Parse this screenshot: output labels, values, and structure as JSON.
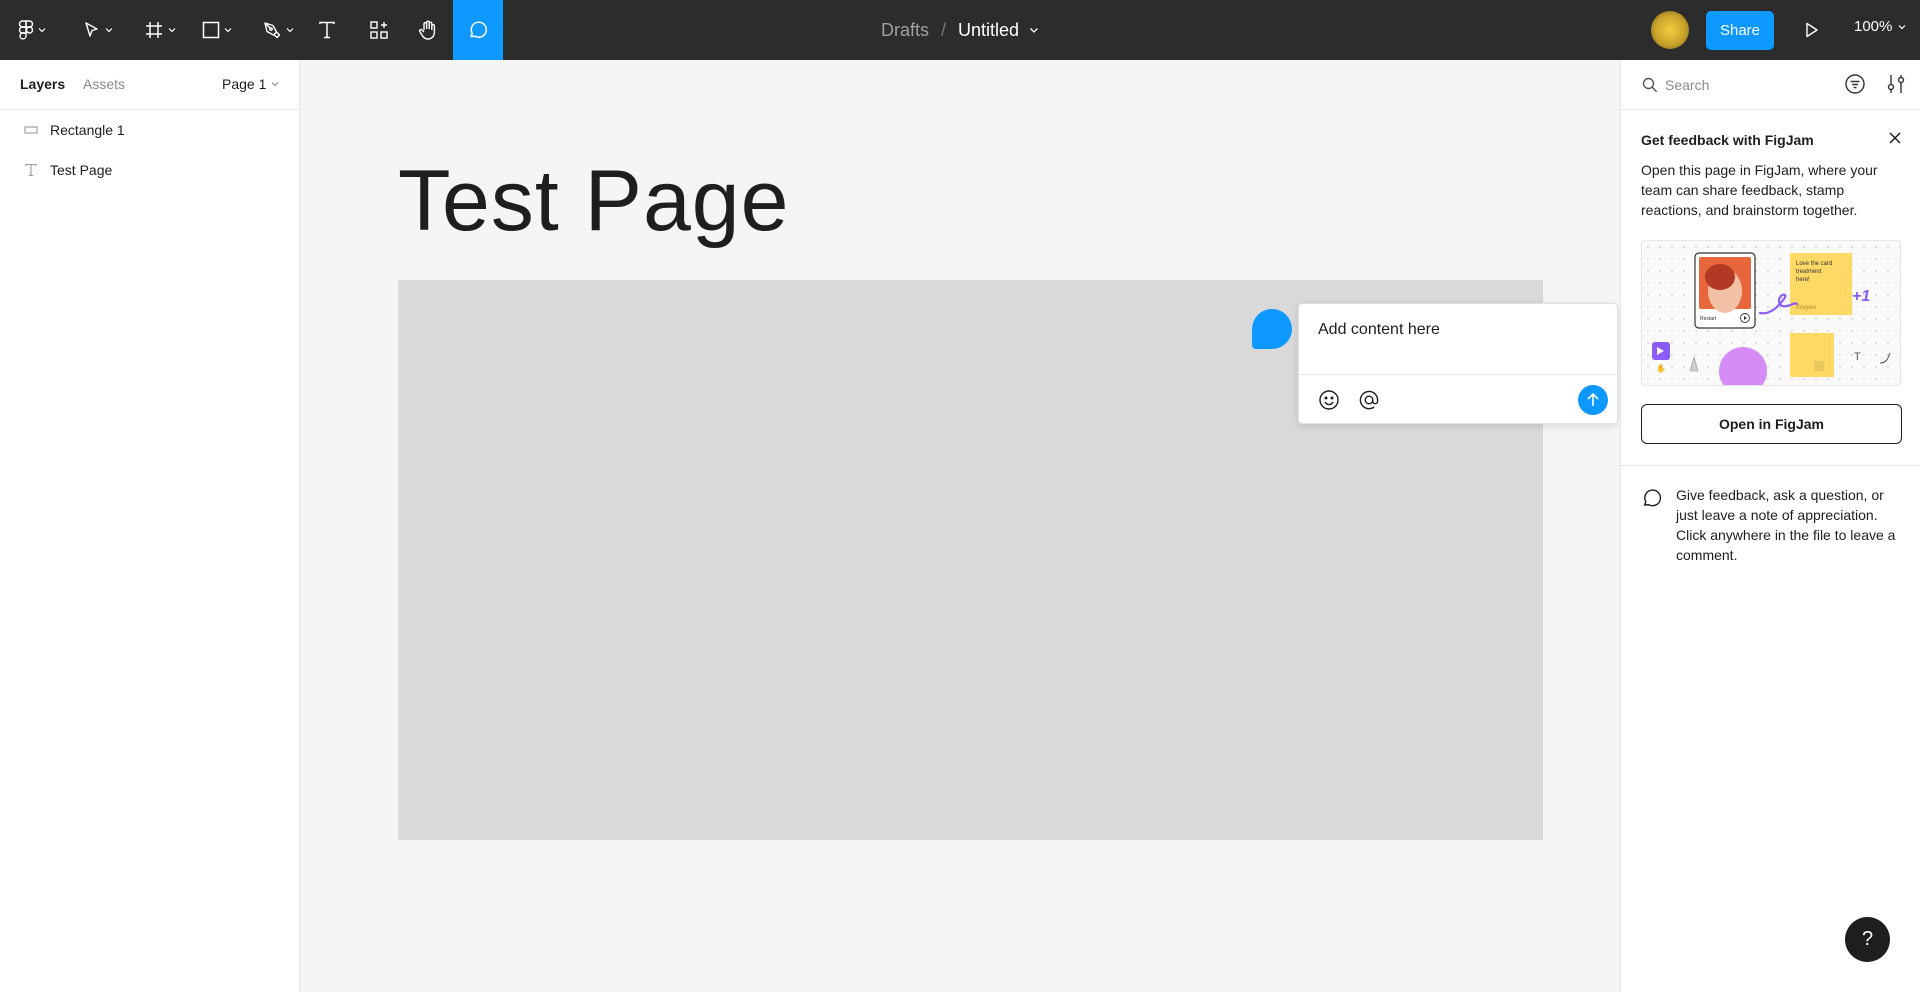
{
  "toolbar": {
    "tools": [
      {
        "name": "main-menu",
        "icon": "figma-logo-icon"
      },
      {
        "name": "move-tool",
        "icon": "cursor-icon"
      },
      {
        "name": "frame-tool",
        "icon": "frame-hash-icon"
      },
      {
        "name": "shape-tool",
        "icon": "rectangle-icon"
      },
      {
        "name": "pen-tool",
        "icon": "pen-icon"
      },
      {
        "name": "text-tool",
        "icon": "text-icon"
      },
      {
        "name": "resources-tool",
        "icon": "components-icon"
      },
      {
        "name": "hand-tool",
        "icon": "hand-icon"
      },
      {
        "name": "comment-tool",
        "icon": "comment-icon",
        "active": true
      }
    ],
    "breadcrumb": {
      "folder": "Drafts",
      "separator": "/",
      "file": "Untitled"
    },
    "share_label": "Share",
    "zoom": "100%"
  },
  "left_panel": {
    "tabs": {
      "layers": "Layers",
      "assets": "Assets"
    },
    "page": "Page 1",
    "layers": [
      {
        "name": "Rectangle 1",
        "icon": "rectangle-layer-icon"
      },
      {
        "name": "Test Page",
        "icon": "text-layer-icon"
      }
    ]
  },
  "canvas": {
    "title": "Test Page",
    "comment": {
      "placeholder": "Add content here"
    }
  },
  "right_panel": {
    "search_placeholder": "Search",
    "figjam": {
      "title": "Get feedback with FigJam",
      "text": "Open this page in FigJam, where your team can share feedback, stamp reactions, and brainstorm together.",
      "illustration": {
        "sticky_text": "Love the card treatment here!",
        "sticky_author": "Koeyen",
        "plus_badge": "+1",
        "card_label": "Restart",
        "tool_glyph": "T"
      },
      "button": "Open in FigJam"
    },
    "hint": "Give feedback, ask a question, or just leave a note of appreciation. Click anywhere in the file to leave a comment."
  },
  "help_label": "?",
  "colors": {
    "toolbar_bg": "#2c2c2c",
    "accent": "#0d99ff",
    "canvas_bg": "#f5f5f5",
    "rectangle_fill": "#d9d9d9"
  }
}
